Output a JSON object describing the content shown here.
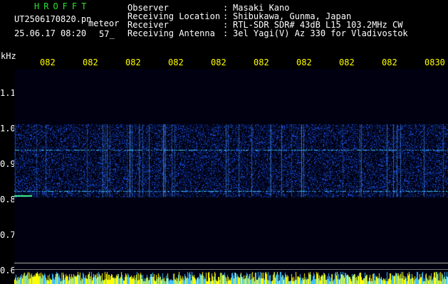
{
  "header": {
    "brand": "HROFFT",
    "filename": "UT2506170820.pn",
    "meteor_label": "meteor",
    "datetime": "25.06.17 08:20",
    "count": "57_"
  },
  "meta": {
    "observer_label": "Observer",
    "observer_value": "Masaki Kano",
    "location_label": "Receiving Location",
    "location_value": "Shibukawa, Gunma, Japan",
    "receiver_label": "Receiver",
    "receiver_value": "RTL-SDR SDR# 43dB L15 103.2MHz CW",
    "antenna_label": "Receiving Antenna",
    "antenna_value": "3el Yagi(V) Az 330 for Vladivostok",
    "separator": ":"
  },
  "axes": {
    "y_unit": "kHz",
    "y_ticks": [
      "1.1",
      "1.0",
      "0.9",
      "0.8",
      "0.7",
      "0.6"
    ],
    "x_ticks": [
      "082",
      "082",
      "082",
      "082",
      "082",
      "082",
      "082",
      "082",
      "082",
      "0830"
    ]
  },
  "colors": {
    "background": "#000000",
    "brand": "#2fe02f",
    "tick_labels": "#ffff00",
    "text": "#ffffff",
    "signal": "#2060ff",
    "signal_hot": "#60e0ff",
    "bottom_band": "#ffff00"
  },
  "spectrogram": {
    "band_low_khz": 0.805,
    "band_high_khz": 1.01,
    "carrier_line_khz": 0.938,
    "lower_line_khz": 0.822
  }
}
